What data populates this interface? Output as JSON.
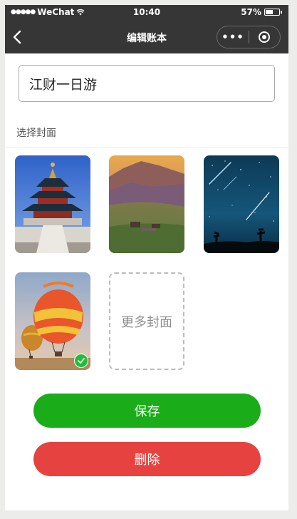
{
  "status_bar": {
    "signal_dots": "●●●●●",
    "carrier": "WeChat",
    "time": "10:40",
    "battery_percent": "57%",
    "battery_level": 0.57
  },
  "nav": {
    "title": "编辑账本",
    "more_glyph": "•••",
    "icons": {
      "back": "back-chevron-icon",
      "more": "more-dots-icon",
      "close": "mini-program-close-icon"
    }
  },
  "form": {
    "name_value": "江财一日游",
    "cover_section_label": "选择封面"
  },
  "covers": [
    {
      "name": "temple-of-heaven",
      "selected": false
    },
    {
      "name": "sunset-mountains",
      "selected": false
    },
    {
      "name": "meteor-night-sky",
      "selected": false
    },
    {
      "name": "hot-air-balloons",
      "selected": true
    }
  ],
  "more_covers_label": "更多封面",
  "actions": {
    "save_label": "保存",
    "delete_label": "删除"
  },
  "colors": {
    "nav_bg": "#363636",
    "save": "#1aad19",
    "delete": "#e64340",
    "selected_check": "#1fbf3a"
  }
}
